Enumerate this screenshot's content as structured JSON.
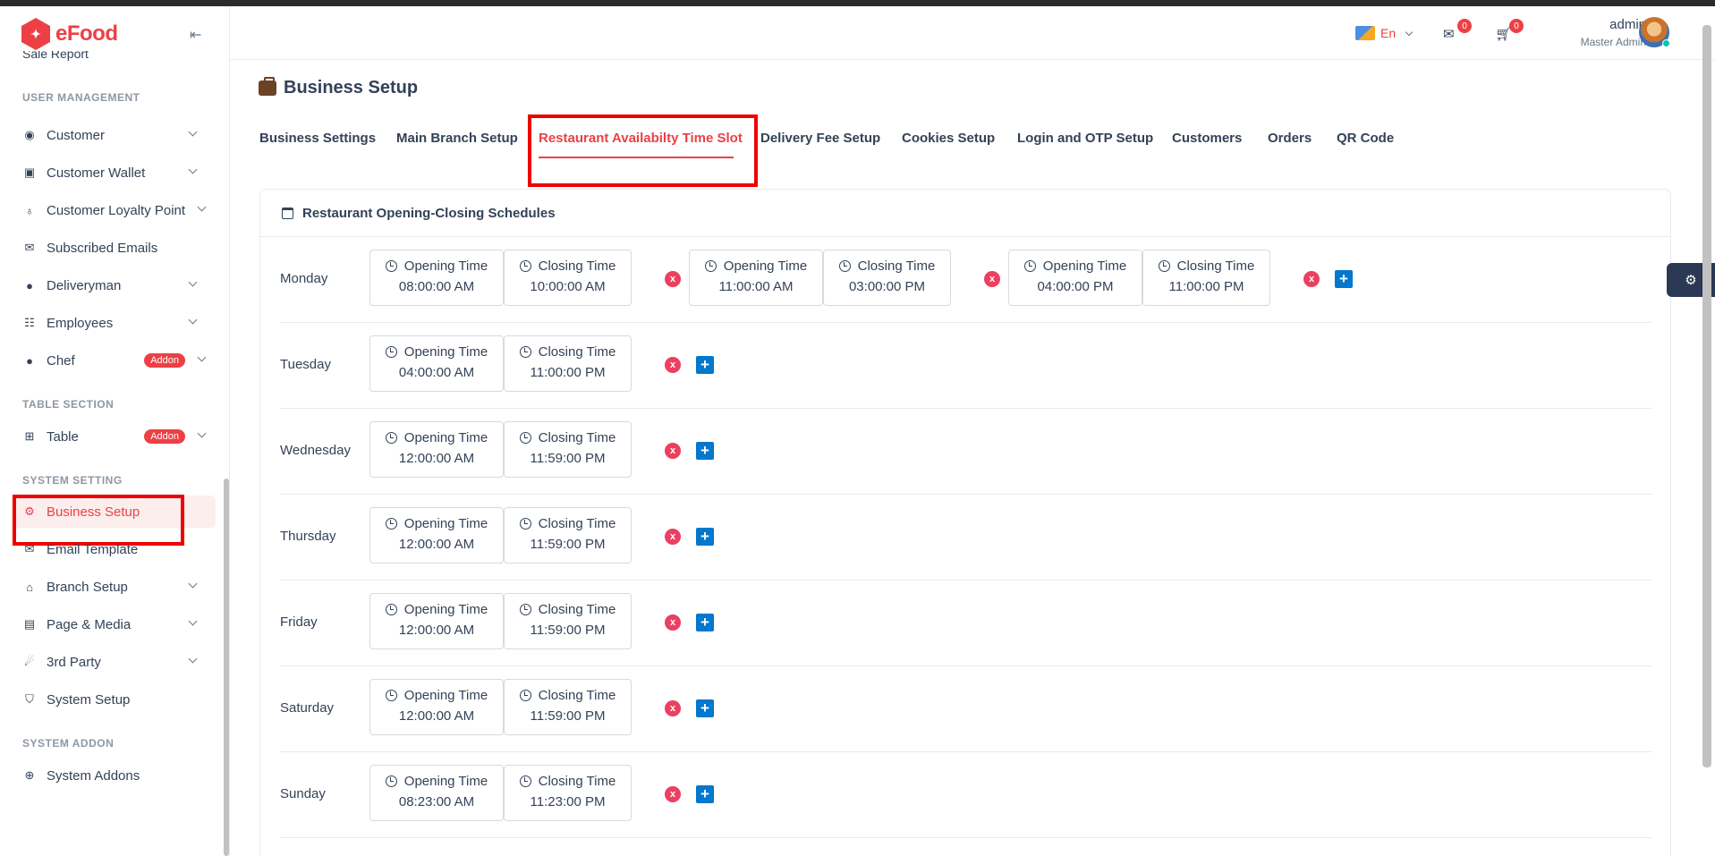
{
  "app": {
    "logo_text": "eFood"
  },
  "sidebar": {
    "partial_item": "Sale Report",
    "sections": {
      "user_management": "USER MANAGEMENT",
      "table_section": "TABLE SECTION",
      "system_setting": "SYSTEM SETTING",
      "system_addon": "SYSTEM ADDON"
    },
    "items": {
      "customer": "Customer",
      "customer_wallet": "Customer Wallet",
      "customer_loyalty_point": "Customer Loyalty Point",
      "subscribed_emails": "Subscribed Emails",
      "deliveryman": "Deliveryman",
      "employees": "Employees",
      "chef": "Chef",
      "table": "Table",
      "business_setup": "Business Setup",
      "email_template": "Email Template",
      "branch_setup": "Branch Setup",
      "page_media": "Page & Media",
      "third_party": "3rd Party",
      "system_setup": "System Setup",
      "system_addons": "System Addons"
    },
    "addon_badge": "Addon"
  },
  "header": {
    "language": "En",
    "messages_count": "0",
    "cart_count": "0",
    "user_name": "admin",
    "user_role": "Master Admin"
  },
  "page": {
    "title": "Business Setup",
    "tabs": [
      "Business Settings",
      "Main Branch Setup",
      "Restaurant Availabilty Time Slot",
      "Delivery Fee Setup",
      "Cookies Setup",
      "Login and OTP Setup",
      "Customers",
      "Orders",
      "QR Code"
    ],
    "card_title": "Restaurant Opening-Closing Schedules",
    "opening_label": "Opening Time",
    "closing_label": "Closing Time",
    "remove_label": "x",
    "add_label": "+"
  },
  "schedule": [
    {
      "day": "Monday",
      "slots": [
        {
          "open": "08:00:00 AM",
          "close": "10:00:00 AM"
        },
        {
          "open": "11:00:00 AM",
          "close": "03:00:00 PM"
        },
        {
          "open": "04:00:00 PM",
          "close": "11:00:00 PM"
        }
      ]
    },
    {
      "day": "Tuesday",
      "slots": [
        {
          "open": "04:00:00 AM",
          "close": "11:00:00 PM"
        }
      ]
    },
    {
      "day": "Wednesday",
      "slots": [
        {
          "open": "12:00:00 AM",
          "close": "11:59:00 PM"
        }
      ]
    },
    {
      "day": "Thursday",
      "slots": [
        {
          "open": "12:00:00 AM",
          "close": "11:59:00 PM"
        }
      ]
    },
    {
      "day": "Friday",
      "slots": [
        {
          "open": "12:00:00 AM",
          "close": "11:59:00 PM"
        }
      ]
    },
    {
      "day": "Saturday",
      "slots": [
        {
          "open": "12:00:00 AM",
          "close": "11:59:00 PM"
        }
      ]
    },
    {
      "day": "Sunday",
      "slots": [
        {
          "open": "08:23:00 AM",
          "close": "11:23:00 PM"
        }
      ]
    }
  ],
  "colors": {
    "brand": "#ec4045",
    "accent_blue": "#0177cd",
    "remove_pink": "#ec4060"
  }
}
